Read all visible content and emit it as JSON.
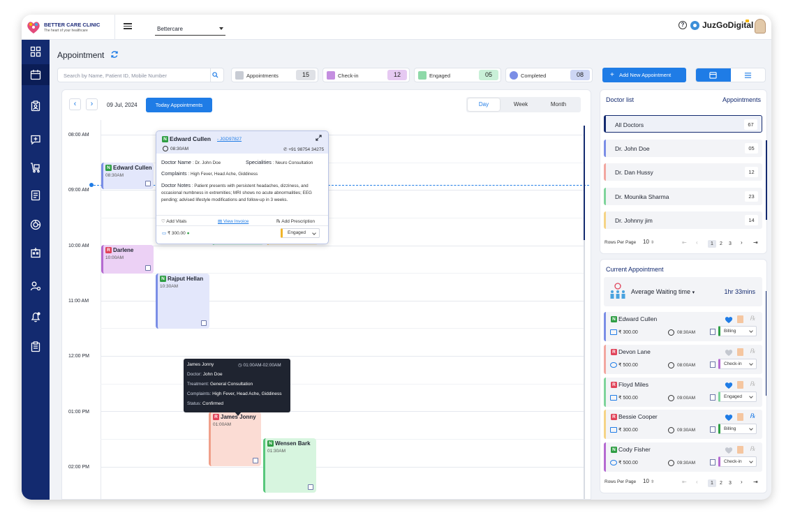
{
  "clinic": {
    "name": "BETTER CARE CLINIC",
    "tagline": "The heart of your healthcare"
  },
  "header": {
    "org_select": "Bettercare",
    "brand": "JuzGoDigital",
    "help": "?"
  },
  "page": {
    "title": "Appointment"
  },
  "search": {
    "placeholder": "Search by Name, Patient ID, Mobile Number"
  },
  "stats": [
    {
      "label": "Appointments",
      "count": "15",
      "color": "#dfe1e6"
    },
    {
      "label": "Check-in",
      "count": "12",
      "color": "#e6c9f2"
    },
    {
      "label": "Engaged",
      "count": "05",
      "color": "#c9f0d8"
    },
    {
      "label": "Completed",
      "count": "08",
      "color": "#cdd6f4"
    }
  ],
  "add_button": {
    "plus": "+",
    "label": "Add New Appointment"
  },
  "calendar": {
    "date": "09 Jul, 2024",
    "prev": "‹",
    "next": "›",
    "today_button": "Today Appointments",
    "views": [
      "Day",
      "Week",
      "Month"
    ],
    "active_view": "Day",
    "time_labels": [
      "08:00 AM",
      "09:00 AM",
      "10:00 AM",
      "11:00 AM",
      "12:00 PM",
      "01:00 PM",
      "02:00 PM"
    ],
    "events": [
      {
        "type": "N",
        "name": "Edward Cullen",
        "time": "08:30AM",
        "color": "#e3e7fb",
        "border": "#7b8ee6"
      },
      {
        "type": "R",
        "name": "Darlene",
        "time": "10:00AM",
        "color": "#ecd1f5",
        "border": "#b56ad1"
      },
      {
        "type": "N",
        "name": "Rajput Hellan",
        "time": "10:30AM",
        "color": "#e3e7fb",
        "border": "#7b8ee6"
      },
      {
        "type": "R",
        "name": "James Jonny",
        "time": "01:00AM",
        "color": "#fbdcd4",
        "border": "#f0a08a"
      },
      {
        "type": "N",
        "name": "Wensen Bark",
        "time": "01:30AM",
        "color": "#d7f5df",
        "border": "#58c77c"
      }
    ]
  },
  "popup": {
    "type": "N",
    "name": "Edward Cullen",
    "id": "JGD97827",
    "time": "08:30AM",
    "phone": "+91 98754 34275",
    "doctor_label": "Doctor Name",
    "doctor": ": Dr. John Doe",
    "speciality_label": "Specialities",
    "speciality": ":  Neuro Consultation",
    "complaints_label": "Complaints",
    "complaints": ":  High Fever, Head Ache, Giddiness",
    "notes_label": "Doctor Notes",
    "notes": ":  Patient presents with persistent headaches, dizziness, and occasional numbness in extremities; MRI shows no acute abnormalities; EEG pending; advised lifestyle modifications and follow-up in 3 weeks.",
    "add_vitals": "Add Vitals",
    "view_invoice": "View Invoice",
    "add_prescription": "Add Prescription",
    "fee": "₹ 300.00",
    "status": "Engaged"
  },
  "tooltip": {
    "name": "James Jonny",
    "time": "01:00AM-02:00AM",
    "doctor_label": "Doctor:",
    "doctor": "John Doe",
    "treatment_label": "Treatment:",
    "treatment": "General Consultation",
    "complaints_label": "Complaints:",
    "complaints": "High Fever, Head Ache, Giddiness",
    "status_label": "Status:",
    "status": "Confirmed"
  },
  "doctor_list": {
    "title": "Doctor list",
    "appointments_label": "Appointments",
    "items": [
      {
        "name": "All Doctors",
        "count": "67",
        "color": "#132a6f"
      },
      {
        "name": "Dr. John Doe",
        "count": "05",
        "color": "#7b8ee6"
      },
      {
        "name": "Dr. Dan Hussy",
        "count": "12",
        "color": "#f2a7a0"
      },
      {
        "name": "Dr. Mounika Sharma",
        "count": "23",
        "color": "#7fd49b"
      },
      {
        "name": "Dr. Johnny jim",
        "count": "14",
        "color": "#f5d486"
      }
    ],
    "pager": {
      "label": "Rows Per Page",
      "rows": "10",
      "pages": [
        "1",
        "2",
        "3"
      ],
      "active_page": "1"
    }
  },
  "current": {
    "title": "Current Appointment",
    "wait_label": "Average Waiting time",
    "wait_value": "1hr 33mins",
    "items": [
      {
        "type": "N",
        "name": "Edward Cullen",
        "fee": "₹ 300.00",
        "time": "08:30AM",
        "status": "Billing",
        "border": "#7b8ee6",
        "status_color": "#2f9e44",
        "sel_color": "#2f9e44"
      },
      {
        "type": "R",
        "name": "Devon Lane",
        "fee": "₹ 500.00",
        "time": "08:00AM",
        "status": "Check-in",
        "border": "#f2a7a0",
        "status_color": "#2f9e44",
        "sel_color": "#b56ad1"
      },
      {
        "type": "R",
        "name": "Floyd Miles",
        "fee": "₹ 500.00",
        "time": "09:00AM",
        "status": "Engaged",
        "border": "#7fd49b",
        "status_color": "#f08c00",
        "sel_color": "#7fd49b"
      },
      {
        "type": "R",
        "name": "Bessie Cooper",
        "fee": "₹ 300.00",
        "time": "09:30AM",
        "status": "Billing",
        "border": "#f5d486",
        "status_color": "#f08c00",
        "sel_color": "#2f9e44"
      },
      {
        "type": "N",
        "name": "Cody Fisher",
        "fee": "₹ 500.00",
        "time": "09:30AM",
        "status": "Check-in",
        "border": "#b56ad1",
        "status_color": "#2f9e44",
        "sel_color": "#b56ad1"
      }
    ],
    "pager": {
      "label": "Rows Per Page",
      "rows": "10",
      "pages": [
        "1",
        "2",
        "3"
      ],
      "active_page": "1"
    }
  }
}
